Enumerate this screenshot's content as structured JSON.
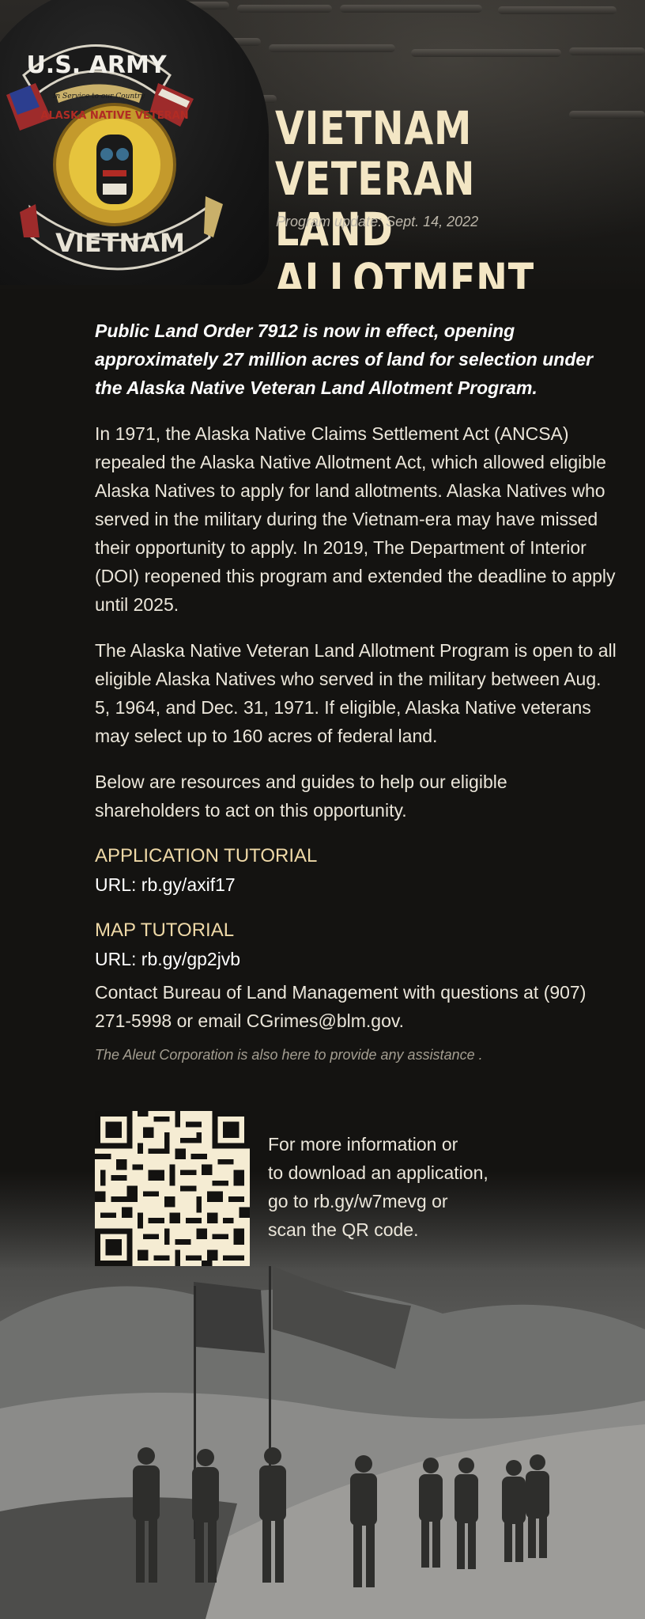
{
  "header": {
    "title_line1": "VIETNAM VETERAN",
    "title_line2": "LAND ALLOTMENT",
    "update": "Program update: Sept. 14, 2022",
    "patch_text_top": "U.S. ARMY",
    "patch_text_ribbon": "In Service to our Country",
    "patch_text_ring": "ALASKA NATIVE VETERAN",
    "patch_text_bottom": "VIETNAM"
  },
  "body": {
    "lead": "Public Land Order 7912 is now in effect, opening approximately 27 million acres of land for selection under the Alaska Native Veteran Land Allotment Program.",
    "para1": "In 1971, the Alaska Native Claims Settlement Act (ANCSA) repealed the Alaska Native Allotment Act, which allowed eligible Alaska Natives to apply for land allotments. Alaska Natives who served in the military during the Vietnam-era may have missed their opportunity to apply. In 2019, The Department of Interior (DOI) reopened this program and extended the deadline to apply until 2025.",
    "para2": "The Alaska Native Veteran Land Allotment Program is open to all eligible Alaska Natives who served in the military between Aug. 5, 1964, and Dec. 31, 1971. If eligible, Alaska Native veterans may select up to 160 acres of federal land.",
    "para3": "Below are resources and guides to help our eligible shareholders to act on this opportunity.",
    "tutorial1_label": "APPLICATION TUTORIAL",
    "tutorial1_url": "URL: rb.gy/axif17",
    "tutorial2_label": "MAP TUTORIAL",
    "tutorial2_url": "URL: rb.gy/gp2jvb",
    "contact": "Contact Bureau of Land Management with questions at (907) 271-5998 or email CGrimes@blm.gov.",
    "aleut_note": "The Aleut Corporation is also here to provide any assistance ."
  },
  "qr": {
    "line1": "For more information or",
    "line2": "to download an application,",
    "line3": "go to rb.gy/w7mevg or",
    "line4": "scan the QR code."
  },
  "colors": {
    "background": "#141311",
    "title": "#f3e6c4",
    "accent_label": "#efd9a7",
    "qr": "#f5ecd3"
  }
}
